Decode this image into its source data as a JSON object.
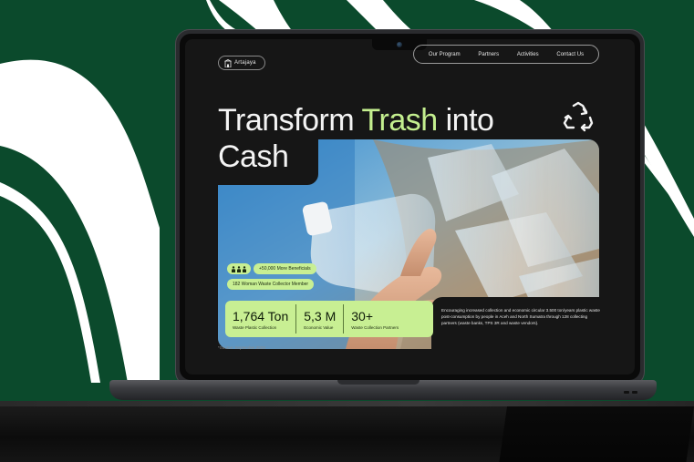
{
  "colors": {
    "background_green": "#0b4a2c",
    "accent_lime": "#c4ef8f",
    "screen_dark": "#161616"
  },
  "brand": {
    "logo_icon": "building-icon",
    "name": "Artajaya"
  },
  "nav": {
    "items": [
      {
        "label": "Our Program"
      },
      {
        "label": "Partners"
      },
      {
        "label": "Activities"
      },
      {
        "label": "Contact Us"
      }
    ]
  },
  "hero": {
    "title_part1": "Transform",
    "title_accent": "Trash",
    "title_part2": "into",
    "title_line2": "Cash",
    "icon": "recycle-icon"
  },
  "badges": {
    "people_icons": "people-icon",
    "beneficials": "+50,000 More Beneficials",
    "members": "182 Woman Waste Collector Member"
  },
  "stats": [
    {
      "value": "1,764 Ton",
      "label": "Waste Plastic Collection"
    },
    {
      "value": "5,3 M",
      "label": "Economic Value"
    },
    {
      "value": "30+",
      "label": "Waste Collection Partners"
    }
  ],
  "description": "Encouraging increased collection and economic circular 3.500 ton/years plastic waste post-consumption by people in Aceh and North Sumatra through 128 collecting partners (waste banks, TPS 3R and waste vendors).",
  "source": "*Source: September 2023"
}
